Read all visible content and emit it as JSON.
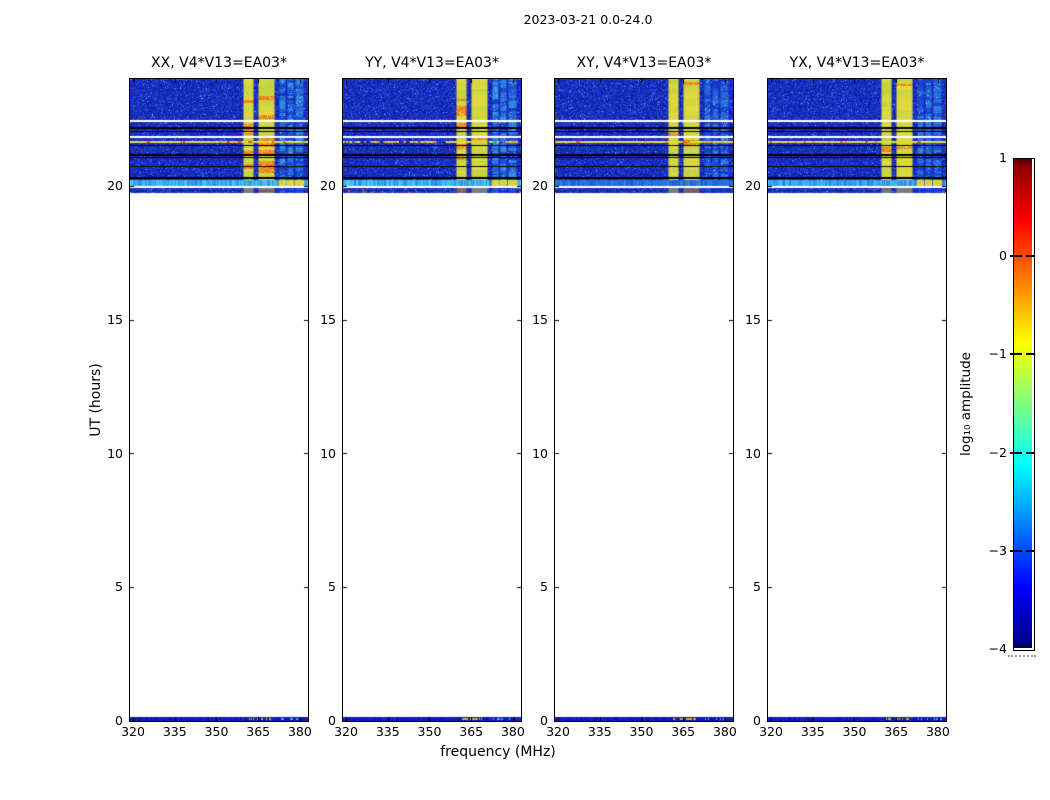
{
  "figure": {
    "title": "2023-03-21 0.0-24.0",
    "background": "#ffffff"
  },
  "chart_data": {
    "type": "heatmap",
    "title": "2023-03-21 0.0-24.0",
    "xlabel": "frequency (MHz)",
    "ylabel": "UT (hours)",
    "xlim": [
      318.9,
      382.9
    ],
    "ylim": [
      0,
      24
    ],
    "xticks": [
      320,
      335,
      350,
      365,
      380
    ],
    "yticks": [
      0,
      5,
      10,
      15,
      20
    ],
    "panels": [
      {
        "pol": "XX",
        "title": "XX, V4*V13=EA03*",
        "seed": 7,
        "hot": 0.22,
        "c_level": 0.55,
        "yline": 1.0,
        "hband_bright": 1.0,
        "hband_yellow": true,
        "tail_dots": 0
      },
      {
        "pol": "YY",
        "title": "YY, V4*V13=EA03*",
        "seed": 19,
        "hot": 0.12,
        "c_level": 0.6,
        "yline": 0.45,
        "hband_bright": 1.0,
        "hband_yellow": true,
        "tail_dots": 9
      },
      {
        "pol": "XY",
        "title": "XY, V4*V13=EA03*",
        "seed": 41,
        "hot": 0.1,
        "c_level": 0.45,
        "yline": 0.85,
        "hband_bright": 0.55,
        "hband_yellow": false,
        "tail_dots": 0
      },
      {
        "pol": "YX",
        "title": "YX, V4*V13=EA03*",
        "seed": 63,
        "hot": 0.15,
        "c_level": 0.5,
        "yline": 0.9,
        "hband_bright": 0.9,
        "hband_yellow": true,
        "tail_dots": 6
      }
    ],
    "features": {
      "top_block": {
        "ut_start": 19.72,
        "ut_end": 24.0
      },
      "bottom_strip": {
        "ut_start": 0.0,
        "ut_end": 0.15
      },
      "bands_mhz": {
        "A": [
          359.5,
          363.6
        ],
        "gap": [
          363.6,
          365.0
        ],
        "B": [
          365.0,
          371.0
        ],
        "C": [
          [
            372.6,
            374.9
          ],
          [
            375.3,
            377.8
          ],
          [
            378.2,
            381.4
          ]
        ],
        "strip_hot": [
          361.0,
          369.5
        ]
      },
      "hlines": [
        {
          "frac": 0.357,
          "color": "white",
          "h": 2
        },
        {
          "frac": 0.424,
          "color": "black",
          "h": 2
        },
        {
          "frac": 0.458,
          "color": "black",
          "h": 1
        },
        {
          "frac": 0.5,
          "color": "white",
          "h": 2
        },
        {
          "frac": 0.54,
          "color": "yellow",
          "h": 2
        },
        {
          "frac": 0.578,
          "color": "black",
          "h": 1
        },
        {
          "frac": 0.657,
          "color": "black",
          "h": 2
        },
        {
          "frac": 0.68,
          "color": "black",
          "h": 1
        },
        {
          "frac": 0.765,
          "color": "black",
          "h": 1
        },
        {
          "frac": 0.862,
          "color": "black",
          "h": 2
        }
      ],
      "hband": {
        "from": 0.885,
        "to": 0.938
      },
      "white_after_hband": 0.942
    },
    "colorbar": {
      "label": "log₁₀ amplitude",
      "tick_labels": [
        "1",
        "0",
        "−1",
        "−2",
        "−3",
        "−4"
      ],
      "tick_values": [
        1,
        0,
        -1,
        -2,
        -3,
        -4
      ],
      "range": [
        -4,
        1
      ],
      "cmap": "jet",
      "cmap_stops": [
        [
          0.0,
          "#00007f"
        ],
        [
          0.125,
          "#0000ff"
        ],
        [
          0.375,
          "#00ffff"
        ],
        [
          0.625,
          "#ffff00"
        ],
        [
          0.875,
          "#ff0000"
        ],
        [
          1.0,
          "#7f0000"
        ]
      ]
    },
    "colors": {
      "noise_dark": "#0a139e",
      "noise_base": "#1226c8",
      "noise_light": "#2e55e8",
      "speckle": "#35aae4",
      "band_yellow": "#e3da3c",
      "band_green": "#a8cf48",
      "band_orange": "#f29d22",
      "band_red": "#e85313",
      "band_cyan": "#3cb4e6",
      "band_cyan_bright": "#86dff4",
      "hband_cyan": "#4ccdee",
      "hband_yellow": "#ddd63e",
      "strip_orange": "#d29227",
      "line_yellow": "#e0dc40",
      "dot_orange": "#e87820",
      "white": "#ffffff",
      "black": "#000000"
    }
  }
}
